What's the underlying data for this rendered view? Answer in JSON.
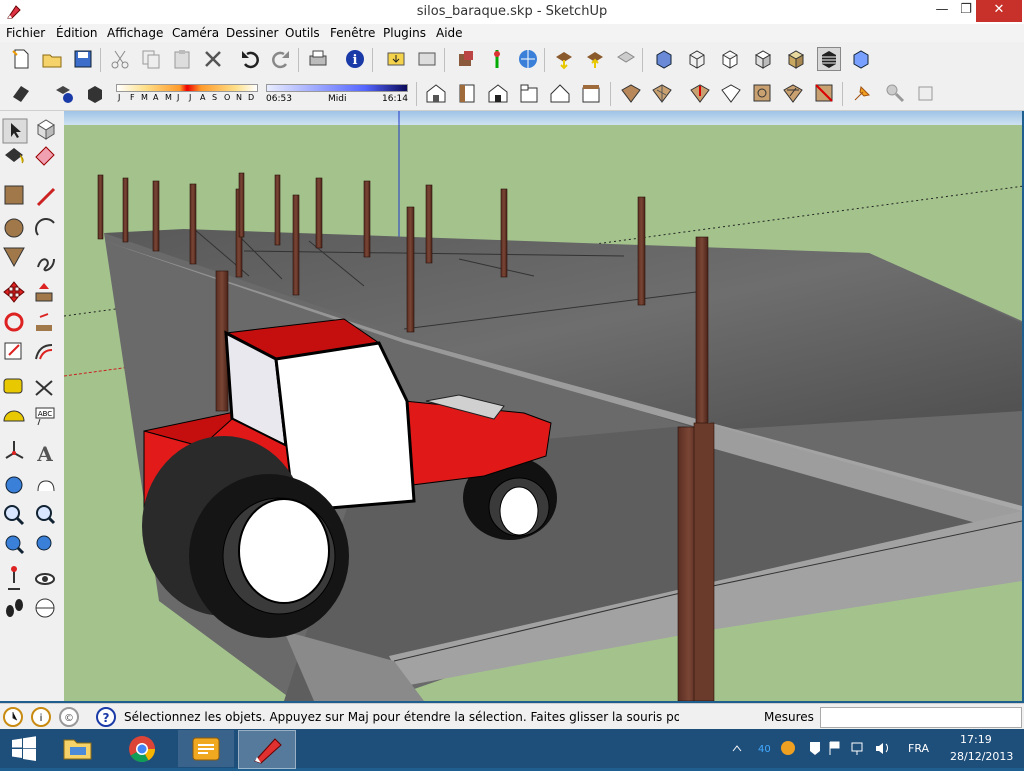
{
  "window": {
    "title": "silos_baraque.skp - SketchUp",
    "min_glyph": "—",
    "max_glyph": "❐",
    "close_glyph": "✕"
  },
  "menu": [
    "Fichier",
    "Édition",
    "Affichage",
    "Caméra",
    "Dessiner",
    "Outils",
    "Fenêtre",
    "Plugins",
    "Aide"
  ],
  "toolbar_top": {
    "icons": [
      "new-icon",
      "open-icon",
      "save-icon",
      "cut-icon",
      "copy-icon",
      "paste-icon",
      "erase-icon",
      "undo-icon",
      "redo-icon",
      "print-icon",
      "model-info-icon",
      "get-models-icon",
      "share-model-icon",
      "component-icon",
      "photo-textures-icon",
      "geo-location-icon",
      "upload-icon",
      "download-icon",
      "share-icon",
      "xray-icon",
      "wireframe-icon",
      "hidden-line-icon",
      "shaded-icon",
      "shaded-texture-icon",
      "monochrome-icon",
      "back-edges-icon"
    ]
  },
  "toolbar_second": {
    "months": [
      "J",
      "F",
      "M",
      "A",
      "M",
      "J",
      "J",
      "A",
      "S",
      "O",
      "N",
      "D"
    ],
    "time_start": "06:53",
    "time_mid": "Midi",
    "time_end": "16:14",
    "icons": [
      "iso-view-icon",
      "top-view-icon",
      "front-view-icon",
      "right-view-icon",
      "back-view-icon",
      "left-view-icon",
      "sandbox-from-contours-icon",
      "sandbox-from-scratch-icon",
      "smoove-icon",
      "stamp-icon",
      "drape-icon",
      "add-detail-icon",
      "flip-edge-icon",
      "pushpin-icon",
      "prefs-icon"
    ]
  },
  "left_tools": [
    "select-icon",
    "make-component-icon",
    "paint-bucket-icon",
    "eraser-icon",
    "rectangle-icon",
    "line-icon",
    "circle-icon",
    "arc-icon",
    "polygon-icon",
    "freehand-icon",
    "move-icon",
    "push-pull-icon",
    "rotate-icon",
    "follow-me-icon",
    "scale-icon",
    "offset-icon",
    "tape-measure-icon",
    "dimension-icon",
    "protractor-icon",
    "text-icon",
    "axes-icon",
    "3d-text-icon",
    "orbit-icon",
    "pan-icon",
    "zoom-icon",
    "zoom-window-icon",
    "zoom-extents-icon",
    "previous-view-icon",
    "position-camera-icon",
    "look-around-icon",
    "walk-icon",
    "section-plane-icon"
  ],
  "status": {
    "icons": [
      "geo-status-icon",
      "credits-icon",
      "user-icon",
      "help-icon"
    ],
    "text": "Sélectionnez les objets. Appuyez sur Maj pour étendre la sélection. Faites glisser la souris pou",
    "measures_label": "Mesures",
    "measures_value": ""
  },
  "taskbar": {
    "items": [
      "start-icon",
      "file-explorer-icon",
      "chrome-icon",
      "sketchup-layout-icon",
      "sketchup-icon"
    ],
    "lang": "FRA",
    "time": "17:19",
    "date": "28/12/2013"
  },
  "colors": {
    "sky": "#b7d3ea",
    "ground": "#a4c38c",
    "tractor_red": "#e01818",
    "accent_blue": "#1a3aa8"
  }
}
